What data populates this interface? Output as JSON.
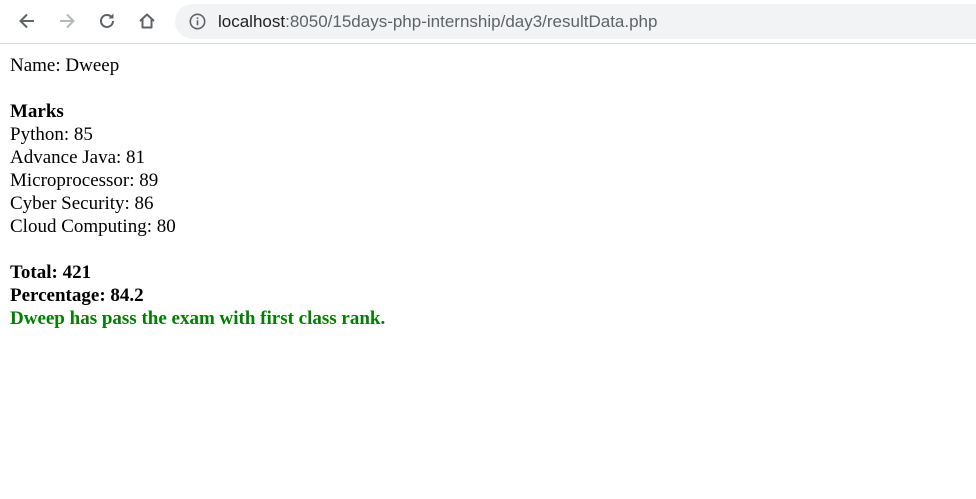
{
  "browser": {
    "url_host": "localhost",
    "url_rest": ":8050/15days-php-internship/day3/resultData.php"
  },
  "student": {
    "name_line": "Name: Dweep"
  },
  "marks": {
    "heading": "Marks",
    "subjects": [
      "Python: 85",
      "Advance Java: 81",
      "Microprocessor: 89",
      "Cyber Security: 86",
      "Cloud Computing: 80"
    ]
  },
  "summary": {
    "total": "Total: 421",
    "percentage": "Percentage: 84.2",
    "result": "Dweep has pass the exam with first class rank."
  },
  "colors": {
    "result_text": "#008000",
    "omnibox_bg": "#f1f3f4"
  }
}
